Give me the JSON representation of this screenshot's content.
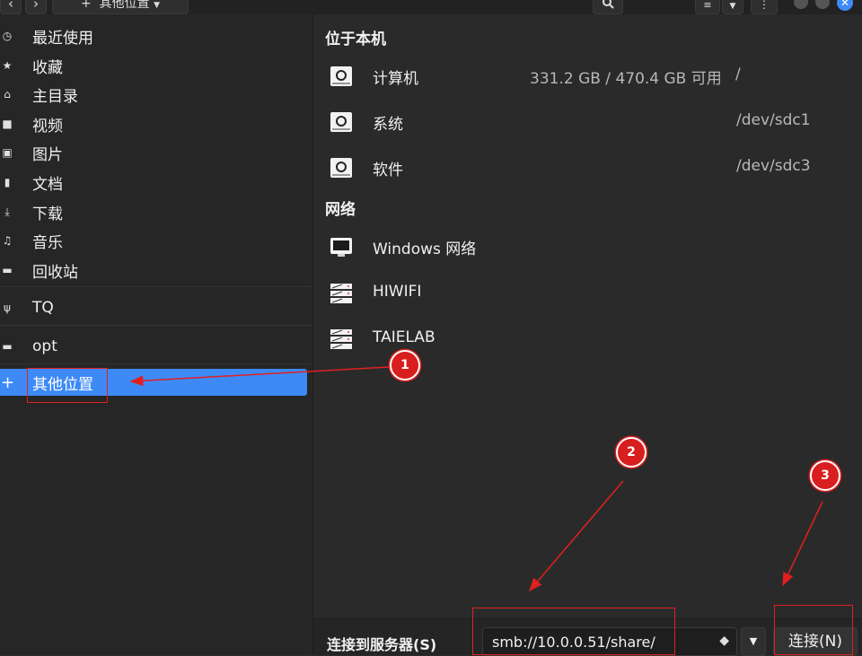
{
  "toolbar": {
    "back_label": "‹",
    "forward_label": "›",
    "location_label": "其他位置",
    "location_icon": "plus-icon",
    "search_icon": "search-icon",
    "view_icon": "list-view-icon",
    "menu_icon": "kebab-icon"
  },
  "sidebar": {
    "items": [
      {
        "icon": "clock-icon",
        "glyph": "◷",
        "label": "最近使用"
      },
      {
        "icon": "star-icon",
        "glyph": "★",
        "label": "收藏"
      },
      {
        "icon": "home-icon",
        "glyph": "⌂",
        "label": "主目录"
      },
      {
        "icon": "video-icon",
        "glyph": "■",
        "label": "视频"
      },
      {
        "icon": "picture-icon",
        "glyph": "▣",
        "label": "图片"
      },
      {
        "icon": "document-icon",
        "glyph": "▮",
        "label": "文档"
      },
      {
        "icon": "download-icon",
        "glyph": "⤓",
        "label": "下载"
      },
      {
        "icon": "music-icon",
        "glyph": "♫",
        "label": "音乐"
      },
      {
        "icon": "trash-icon",
        "glyph": "▬",
        "label": "回收站"
      },
      {
        "icon": "usb-icon",
        "glyph": "ψ",
        "label": "TQ"
      },
      {
        "icon": "folder-icon",
        "glyph": "▬",
        "label": "opt"
      },
      {
        "icon": "plus-icon",
        "glyph": "+",
        "label": "其他位置"
      }
    ]
  },
  "main": {
    "local_title": "位于本机",
    "network_title": "网络",
    "local_items": [
      {
        "icon": "drive-icon",
        "name": "计算机",
        "info": "331.2 GB / 470.4 GB 可用",
        "path": "/"
      },
      {
        "icon": "drive-icon",
        "name": "系统",
        "info": "",
        "path": "/dev/sdc1"
      },
      {
        "icon": "drive-icon",
        "name": "软件",
        "info": "",
        "path": "/dev/sdc3"
      }
    ],
    "network_items": [
      {
        "icon": "network-monitor-icon",
        "name": "Windows 网络"
      },
      {
        "icon": "server-icon",
        "name": "HIWIFI"
      },
      {
        "icon": "server-icon",
        "name": "TAIELAB"
      }
    ]
  },
  "bottom": {
    "connect_label": "连接到服务器(S)",
    "server_value": "smb://10.0.0.51/share/",
    "hint_icon": "help-diamond-icon",
    "hint_glyph": "◆",
    "dropdown_glyph": "▼",
    "connect_button": "连接(N)"
  },
  "annotations": {
    "badge1": "1",
    "badge2": "2",
    "badge3": "3",
    "color": "#e02020"
  }
}
